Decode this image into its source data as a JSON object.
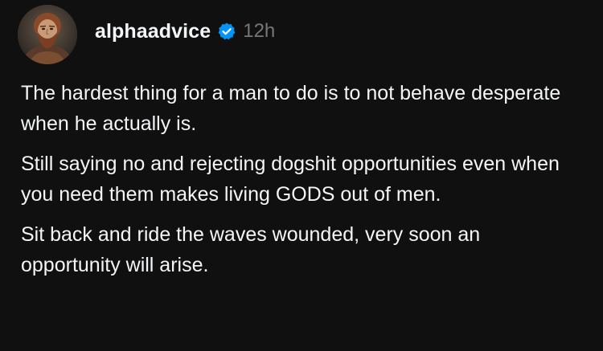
{
  "post": {
    "author": {
      "username": "alphaadvice",
      "verified": true,
      "avatar_icon": "bearded-man-avatar"
    },
    "timestamp": "12h",
    "paragraphs": [
      "The hardest thing for a man to do is to not behave desperate when he actually is.",
      "Still saying no and rejecting dogshit opportunities even when you need them makes living GODS out of men.",
      "Sit back and ride the waves wounded, very soon an opportunity will arise."
    ]
  },
  "colors": {
    "background": "#101010",
    "text": "#f3f5f7",
    "muted": "#777777",
    "verified": "#0095f6"
  }
}
